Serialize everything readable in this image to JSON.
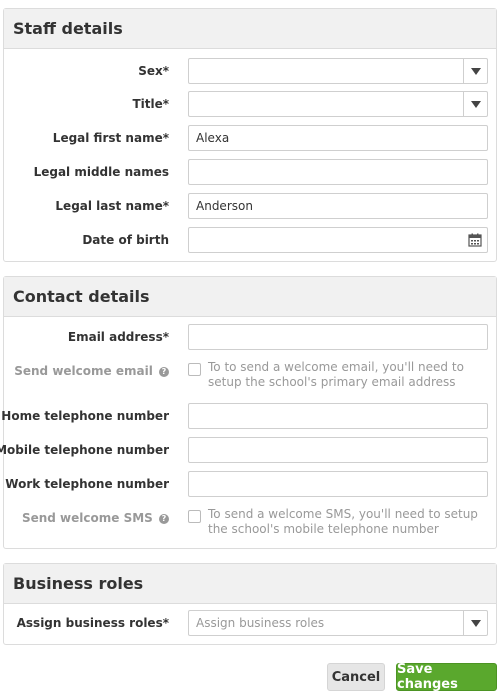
{
  "staff_details": {
    "title": "Staff details",
    "sex": {
      "label": "Sex*",
      "value": ""
    },
    "title_field": {
      "label": "Title*",
      "value": ""
    },
    "first_name": {
      "label": "Legal first name*",
      "value": "Alexa"
    },
    "middle_names": {
      "label": "Legal middle names",
      "value": ""
    },
    "last_name": {
      "label": "Legal last name*",
      "value": "Anderson"
    },
    "dob": {
      "label": "Date of birth",
      "value": ""
    }
  },
  "contact_details": {
    "title": "Contact details",
    "email": {
      "label": "Email address*",
      "value": ""
    },
    "welcome_email": {
      "label": "Send welcome email",
      "help": "To to send a welcome email, you'll need to setup the school's primary email address"
    },
    "home_phone": {
      "label": "Home telephone number",
      "value": ""
    },
    "mobile_phone": {
      "label": "Mobile telephone number",
      "value": ""
    },
    "work_phone": {
      "label": "Work telephone number",
      "value": ""
    },
    "welcome_sms": {
      "label": "Send welcome SMS",
      "help": "To send a welcome SMS, you'll need to setup the school's mobile telephone number"
    }
  },
  "business_roles": {
    "title": "Business roles",
    "assign": {
      "label": "Assign business roles*",
      "placeholder": "Assign business roles"
    }
  },
  "actions": {
    "cancel": "Cancel",
    "save": "Save changes"
  },
  "icons": {
    "select": "chevron-down-icon",
    "date": "calendar-icon",
    "help": "question-icon"
  }
}
